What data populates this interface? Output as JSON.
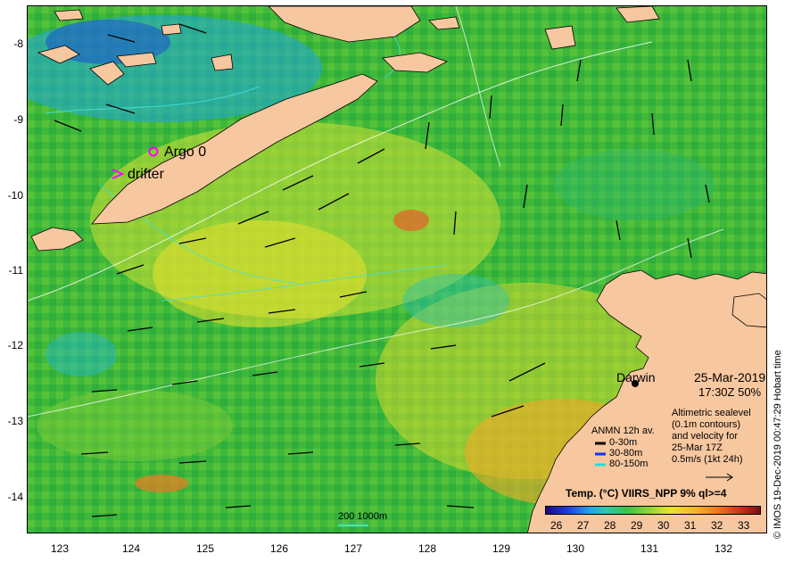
{
  "map": {
    "lat_labels": [
      "-8",
      "-9",
      "-10",
      "-11",
      "-12",
      "-13",
      "-14"
    ],
    "lon_labels": [
      "123",
      "124",
      "125",
      "126",
      "127",
      "128",
      "129",
      "130",
      "131",
      "132"
    ],
    "station_name": "Darwin",
    "date": "25-Mar-2019",
    "time_pct": "17:30Z  50%",
    "altimetry_note": [
      "Altimetric sealevel",
      "(0.1m contours)",
      "and velocity for",
      "25-Mar 17Z",
      "0.5m/s (1kt 24h)"
    ],
    "legend_title": "ANMN 12h av.",
    "legend_items": [
      {
        "label": "0-30m",
        "color": "#000000"
      },
      {
        "label": "30-80m",
        "color": "#1030ff"
      },
      {
        "label": "80-150m",
        "color": "#20e0e0"
      }
    ],
    "colorbar_title": "Temp. (°C) VIIRS_NPP 9% ql>=4",
    "colorbar_ticks": [
      "26",
      "27",
      "28",
      "29",
      "30",
      "31",
      "32",
      "33"
    ],
    "scale_label": "200  1000m",
    "argo_label": "Argo 0",
    "drifter_label": "drifter",
    "side_credit": "© IMOS 19-Dec-2019 00:47:29 Hobart time",
    "colors": {
      "land": "#f7c79f",
      "sea": "#3fb83a",
      "marker": "#ff00ff",
      "contour": "#40e0e0"
    }
  }
}
